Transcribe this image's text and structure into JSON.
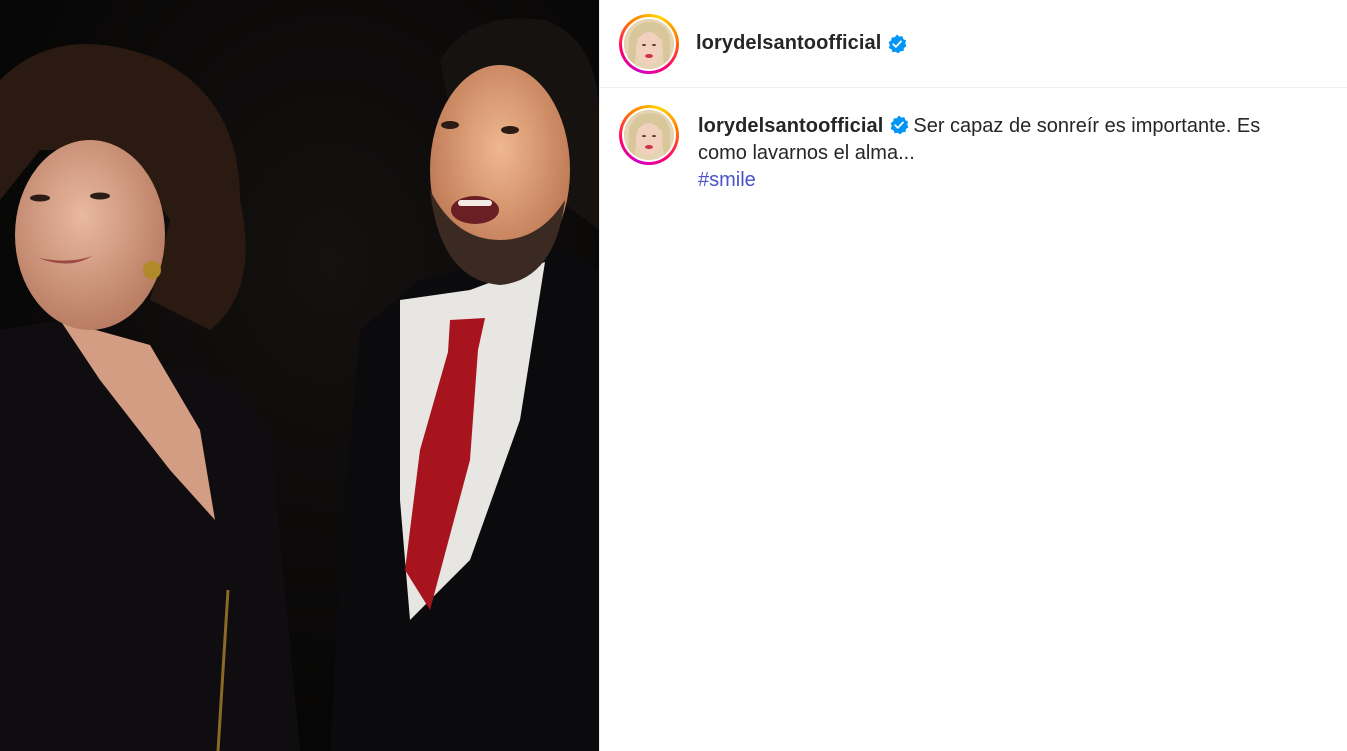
{
  "post": {
    "author": {
      "username": "lorydelsantoofficial",
      "verified_icon": "verified-badge-icon",
      "verified_color": "#0095f6"
    },
    "caption": {
      "text": "Ser capaz de sonreír es importante. Es como lavarnos el alma...",
      "hashtag": "#smile"
    },
    "colors": {
      "hashtag": "#4a54c8",
      "text": "#262626",
      "divider": "#efefef"
    }
  }
}
